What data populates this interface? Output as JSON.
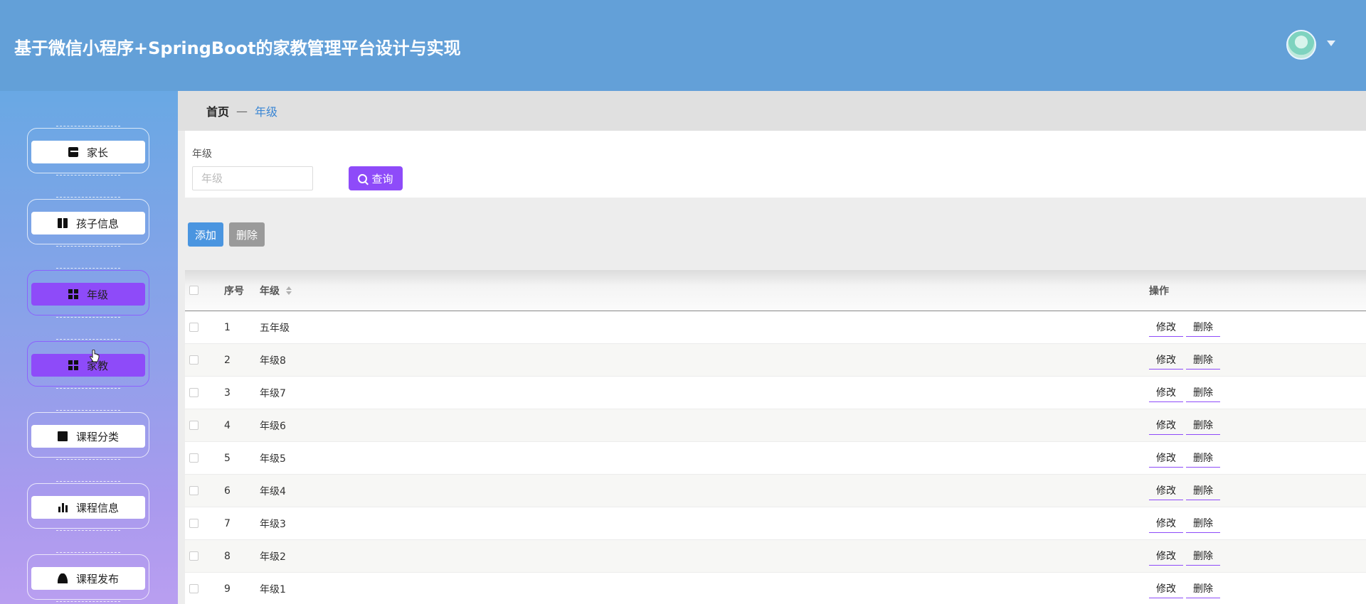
{
  "header": {
    "title": "基于微信小程序+SpringBoot的家教管理平台设计与实现"
  },
  "sidebar": {
    "items": [
      {
        "label": "家长",
        "icon": "chat-icon",
        "active": false
      },
      {
        "label": "孩子信息",
        "icon": "book-icon",
        "active": false
      },
      {
        "label": "年级",
        "icon": "grid-icon",
        "active": true
      },
      {
        "label": "家教",
        "icon": "grid-icon",
        "active": true
      },
      {
        "label": "课程分类",
        "icon": "monitor-icon",
        "active": false
      },
      {
        "label": "课程信息",
        "icon": "bar-chart-icon",
        "active": false
      },
      {
        "label": "课程发布",
        "icon": "user-icon",
        "active": false
      }
    ]
  },
  "breadcrumb": {
    "home": "首页",
    "separator": "—",
    "current": "年级"
  },
  "search": {
    "label": "年级",
    "placeholder": "年级",
    "value": "",
    "query_label": "查询"
  },
  "actions": {
    "add_label": "添加",
    "delete_label": "删除"
  },
  "table": {
    "headers": {
      "index": "序号",
      "grade": "年级",
      "ops": "操作"
    },
    "edit_label": "修改",
    "delete_label": "删除",
    "rows": [
      {
        "index": "1",
        "grade": "五年级"
      },
      {
        "index": "2",
        "grade": "年级8"
      },
      {
        "index": "3",
        "grade": "年级7"
      },
      {
        "index": "4",
        "grade": "年级6"
      },
      {
        "index": "5",
        "grade": "年级5"
      },
      {
        "index": "6",
        "grade": "年级4"
      },
      {
        "index": "7",
        "grade": "年级3"
      },
      {
        "index": "8",
        "grade": "年级2"
      },
      {
        "index": "9",
        "grade": "年级1"
      }
    ]
  },
  "colors": {
    "header_bg": "#63a0d8",
    "accent_purple": "#8e4bf9",
    "add_button": "#4a95e0",
    "delete_button": "#9a9a9a",
    "breadcrumb_current": "#3a86d4"
  }
}
